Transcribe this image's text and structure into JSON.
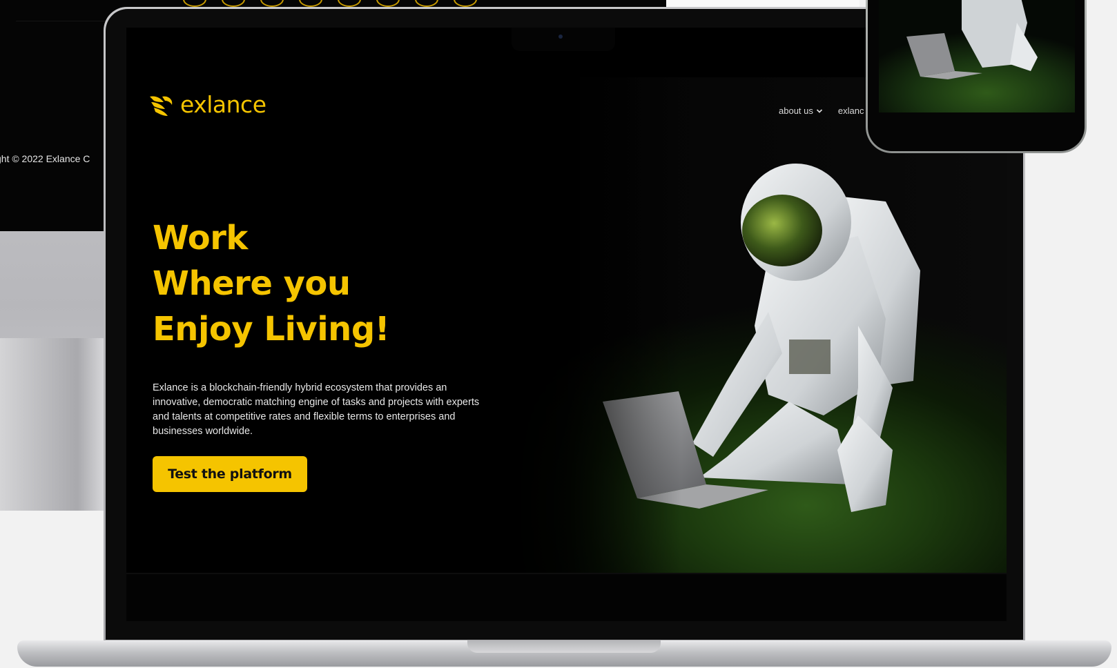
{
  "background_monitor": {
    "copyright": "ght ©  2022 Exlance C"
  },
  "site": {
    "brand": "exlance",
    "nav": [
      {
        "label": "about us",
        "has_dropdown": true
      },
      {
        "label": "exlanc",
        "has_dropdown": false
      }
    ],
    "hero": {
      "title_lines": [
        "Work",
        "Where you",
        "Enjoy Living!"
      ],
      "description": "Exlance is a blockchain-friendly hybrid ecosystem that provides an innovative, democratic matching engine of tasks and projects with experts and talents at competitive rates and flexible terms to enterprises and businesses worldwide.",
      "cta_label": "Test the platform"
    }
  },
  "colors": {
    "brand_yellow": "#f5c400",
    "screen_bg": "#000000",
    "page_bg": "#f2f2f2"
  },
  "icons": {
    "logo": "exlance-bird-logo-icon",
    "dropdown": "chevron-down-icon"
  }
}
